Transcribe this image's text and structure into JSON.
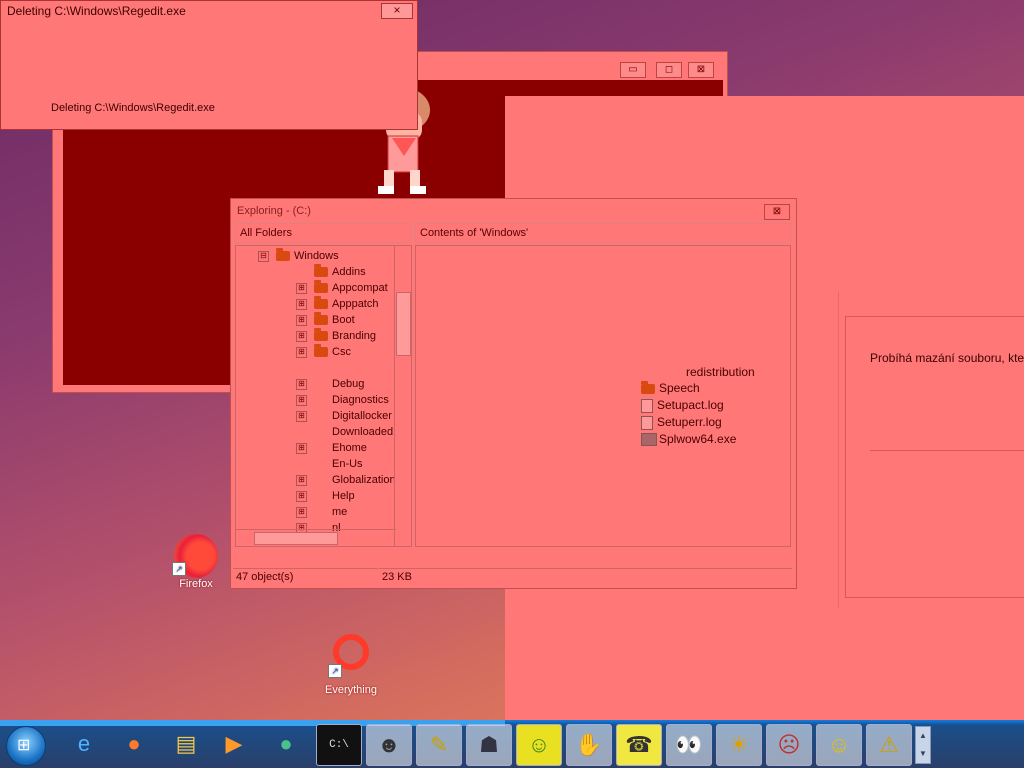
{
  "deleting_dialog": {
    "title": "Deleting C:\\Windows\\Regedit.exe",
    "close_label": "×",
    "message": "Deleting C:\\Windows\\Regedit.exe"
  },
  "back_window": {
    "min_label": "▭",
    "max_label": "◻",
    "close_label": "⊠"
  },
  "explorer": {
    "title": "Exploring - (C:)",
    "close_label": "⊠",
    "left_header": "All Folders",
    "right_header": "Contents of 'Windows'",
    "tree_items": [
      {
        "label": "Windows",
        "expanded": "⊟"
      },
      {
        "label": "Addins",
        "expanded": ""
      },
      {
        "label": "Appcompat",
        "expanded": "⊞"
      },
      {
        "label": "Apppatch",
        "expanded": "⊞"
      },
      {
        "label": "Boot",
        "expanded": "⊞"
      },
      {
        "label": "Branding",
        "expanded": "⊞"
      },
      {
        "label": "Csc",
        "expanded": "⊞"
      },
      {
        "label": "Debug",
        "expanded": "⊞"
      },
      {
        "label": "Diagnostics",
        "expanded": "⊞"
      },
      {
        "label": "Digitallocker",
        "expanded": "⊞"
      },
      {
        "label": "Downloaded",
        "expanded": ""
      },
      {
        "label": "Ehome",
        "expanded": "⊞"
      },
      {
        "label": "En-Us",
        "expanded": ""
      },
      {
        "label": "Globalization",
        "expanded": "⊞"
      },
      {
        "label": "Help",
        "expanded": "⊞"
      },
      {
        "label": "me",
        "expanded": "⊞"
      },
      {
        "label": "nl",
        "expanded": "⊞"
      }
    ],
    "content_items": [
      {
        "label": "redistribution",
        "icon": "none"
      },
      {
        "label": "Speech",
        "icon": "folder-icon"
      },
      {
        "label": "Setupact.log",
        "icon": "file-icon"
      },
      {
        "label": "Setuperr.log",
        "icon": "file-icon"
      },
      {
        "label": "Splwow64.exe",
        "icon": "exe-icon"
      }
    ],
    "status_objects": "47 object(s)",
    "status_size": "23 KB"
  },
  "czech_window": {
    "message": "Probíhá mazání souboru, které n"
  },
  "desktop": {
    "firefox_label": "Firefox",
    "everything_label": "Everything"
  },
  "taskbar": {
    "items": [
      {
        "name": "ie-icon",
        "glyph": "e"
      },
      {
        "name": "firefox-taskbar-icon",
        "glyph": "●"
      },
      {
        "name": "file-explorer-icon",
        "glyph": "▤"
      },
      {
        "name": "media-player-icon",
        "glyph": "▶"
      },
      {
        "name": "chat-icon",
        "glyph": "●"
      },
      {
        "name": "cmd-icon",
        "glyph": "C:\\"
      },
      {
        "name": "gorilla-icon",
        "glyph": "☻"
      },
      {
        "name": "pencil-icon",
        "glyph": "✎"
      },
      {
        "name": "dog-icon",
        "glyph": "☗"
      },
      {
        "name": "goblin-icon",
        "glyph": "☺"
      },
      {
        "name": "hands-icon",
        "glyph": "✋"
      },
      {
        "name": "phone-icon",
        "glyph": "☎"
      },
      {
        "name": "eyes-icon",
        "glyph": "👀"
      },
      {
        "name": "sun-icon",
        "glyph": "☀"
      },
      {
        "name": "face-icon",
        "glyph": "☹"
      },
      {
        "name": "smiley-icon",
        "glyph": "☺"
      },
      {
        "name": "warning-icon",
        "glyph": "⚠"
      }
    ],
    "scroll_up": "▲",
    "scroll_down": "▼"
  },
  "colors": {
    "overlay": "#ff7777",
    "dark_area": "#8a0000",
    "taskbar": "#2a3f6a"
  }
}
